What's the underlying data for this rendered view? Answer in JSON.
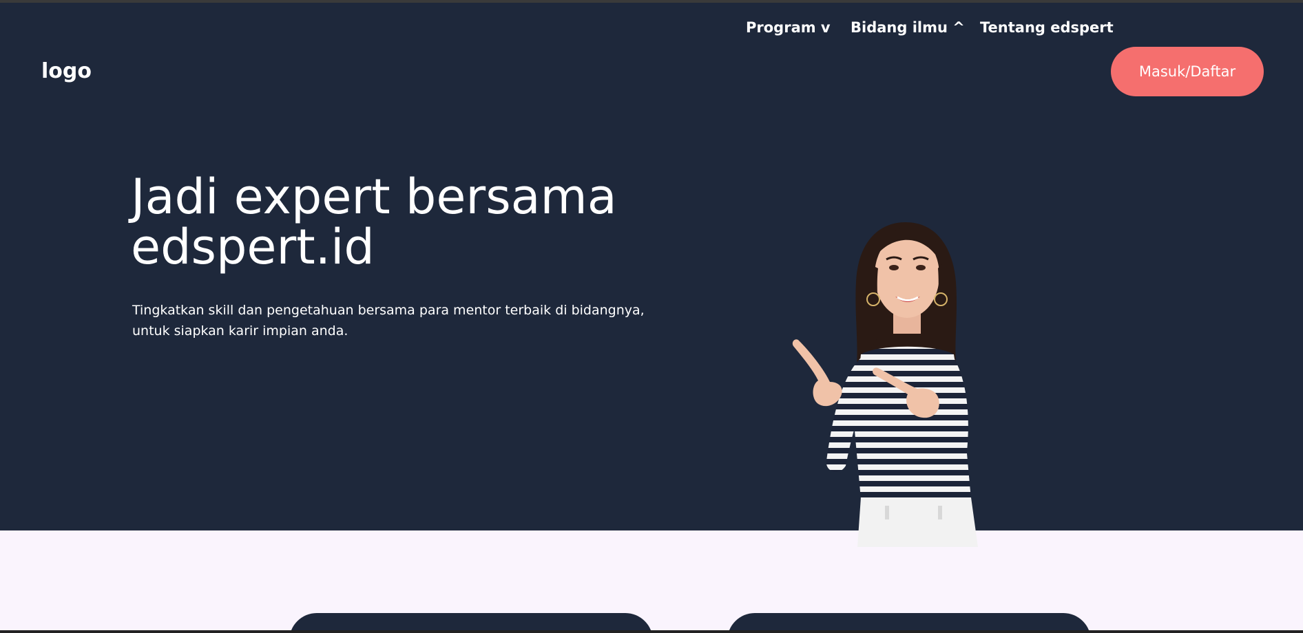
{
  "header": {
    "logo": "logo",
    "nav": {
      "program": "Program v",
      "bidang": "Bidang ilmu ^",
      "tentang": "Tentang edspert"
    },
    "cta": "Masuk/Daftar"
  },
  "hero": {
    "headline_line1": "Jadi expert bersama",
    "headline_line2": "edspert.id",
    "subtitle_line1": "Tingkatkan skill dan pengetahuan bersama para mentor terbaik di bidangnya,",
    "subtitle_line2": "untuk siapkan karir impian anda."
  },
  "colors": {
    "hero_bg": "#1e283b",
    "cta": "#f56f6e",
    "lower_bg": "#faf4fd"
  }
}
